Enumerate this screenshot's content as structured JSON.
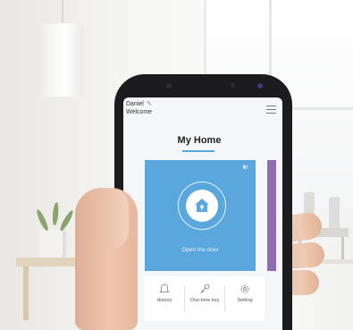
{
  "app": {
    "user_name": "Daniel",
    "greeting": "Welcome",
    "title": "My Home",
    "accent_color": "#5aa7dd",
    "side_card_color": "#8e6cb6",
    "door_card": {
      "label": "Open the door",
      "icon": "home-icon"
    },
    "actions": [
      {
        "label": "History",
        "icon": "bell-icon"
      },
      {
        "label": "One-time key",
        "icon": "key-icon"
      },
      {
        "label": "Setting",
        "icon": "gear-icon"
      }
    ]
  }
}
